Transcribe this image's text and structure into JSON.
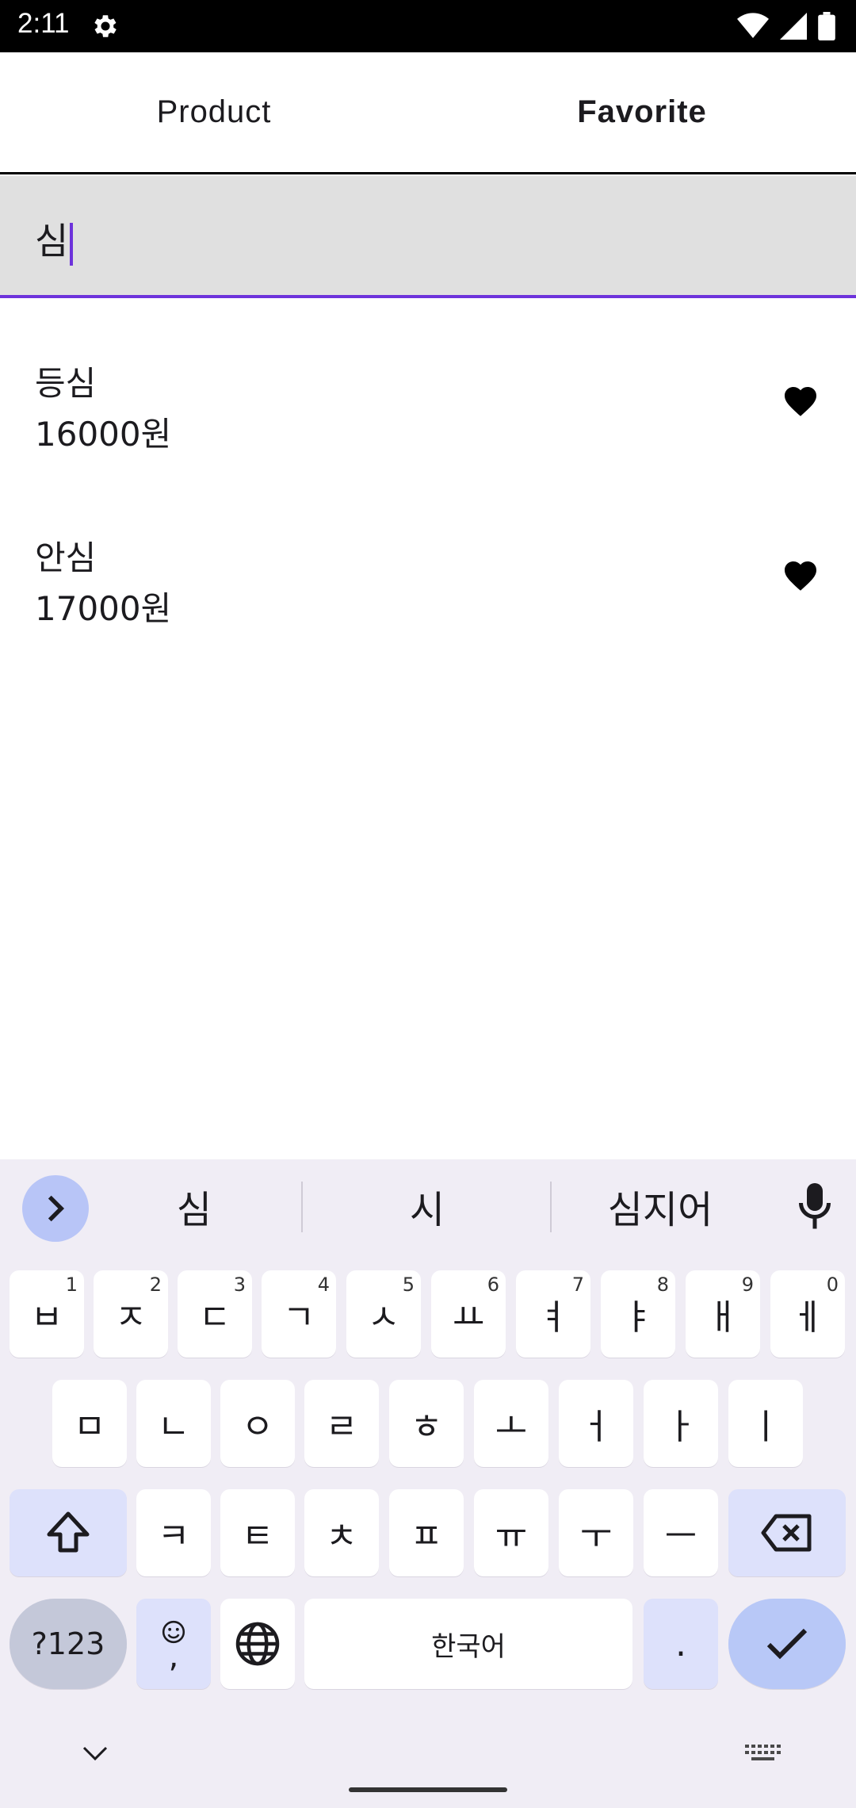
{
  "status_bar": {
    "time": "2:11"
  },
  "tabs": [
    {
      "label": "Product",
      "active": false
    },
    {
      "label": "Favorite",
      "active": true
    }
  ],
  "search": {
    "value": "심"
  },
  "items": [
    {
      "name": "등심",
      "price": "16000원",
      "favorite": true
    },
    {
      "name": "안심",
      "price": "17000원",
      "favorite": true
    }
  ],
  "keyboard": {
    "suggestions": [
      "심",
      "시",
      "심지어"
    ],
    "row1": [
      {
        "key": "ㅂ",
        "num": "1"
      },
      {
        "key": "ㅈ",
        "num": "2"
      },
      {
        "key": "ㄷ",
        "num": "3"
      },
      {
        "key": "ㄱ",
        "num": "4"
      },
      {
        "key": "ㅅ",
        "num": "5"
      },
      {
        "key": "ㅛ",
        "num": "6"
      },
      {
        "key": "ㅕ",
        "num": "7"
      },
      {
        "key": "ㅑ",
        "num": "8"
      },
      {
        "key": "ㅐ",
        "num": "9"
      },
      {
        "key": "ㅔ",
        "num": "0"
      }
    ],
    "row2": [
      "ㅁ",
      "ㄴ",
      "ㅇ",
      "ㄹ",
      "ㅎ",
      "ㅗ",
      "ㅓ",
      "ㅏ",
      "ㅣ"
    ],
    "row3": [
      "ㅋ",
      "ㅌ",
      "ㅊ",
      "ㅍ",
      "ㅠ",
      "ㅜ",
      "ㅡ"
    ],
    "symbols_label": "?123",
    "emoji_comma_label": ",",
    "space_label": "한국어",
    "period_label": "."
  },
  "colors": {
    "accent": "#6d33db",
    "keyboard_bg": "#f0edf5",
    "function_key": "#dde1fb",
    "enter_key": "#b8c8f7"
  }
}
